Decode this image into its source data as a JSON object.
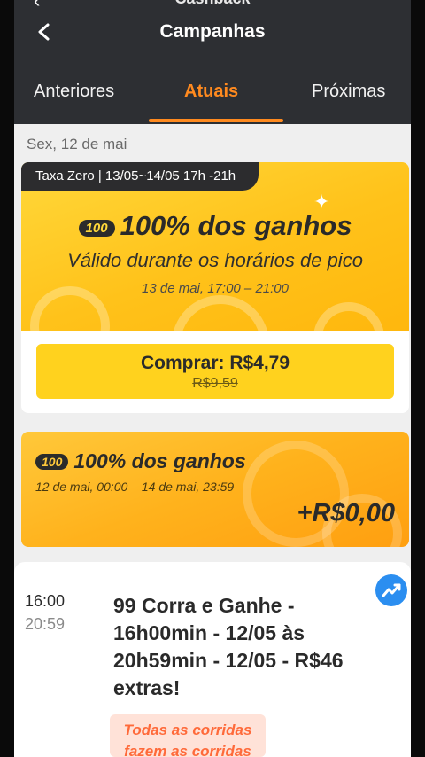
{
  "header": {
    "top_cut_title": "Cashback",
    "title": "Campanhas"
  },
  "tabs": [
    {
      "label": "Anteriores",
      "active": false
    },
    {
      "label": "Atuais",
      "active": true
    },
    {
      "label": "Próximas",
      "active": false
    }
  ],
  "date_label": "Sex, 12 de mai",
  "campaign1": {
    "tag": "Taxa Zero | 13/05~14/05 17h -21h",
    "badge": "100",
    "headline": "100% dos ganhos",
    "subtitle": "Válido durante os horários de pico",
    "period": "13 de mai, 17:00 – 21:00",
    "buy_label": "Comprar: R$4,79",
    "old_price": "R$9,59"
  },
  "campaign2": {
    "badge": "100",
    "headline": "100% dos ganhos",
    "period": "12 de mai, 00:00 – 14 de mai, 23:59",
    "amount": "+R$0,00"
  },
  "campaign3": {
    "start_time": "16:00",
    "end_time": "20:59",
    "text": "99 Corra e Ganhe - 16h00min - 12/05 às 20h59min - 12/05 - R$46 extras!",
    "chip_line1": "Todas as corridas",
    "chip_line2": "fazem as corridas",
    "icon": "trending-up-icon"
  },
  "colors": {
    "header_bg": "#2d2f33",
    "accent": "#ff8a1f",
    "banner_yellow": "#ffc21a",
    "button_yellow": "#ffd21e",
    "trend_blue": "#2b8ef0"
  }
}
